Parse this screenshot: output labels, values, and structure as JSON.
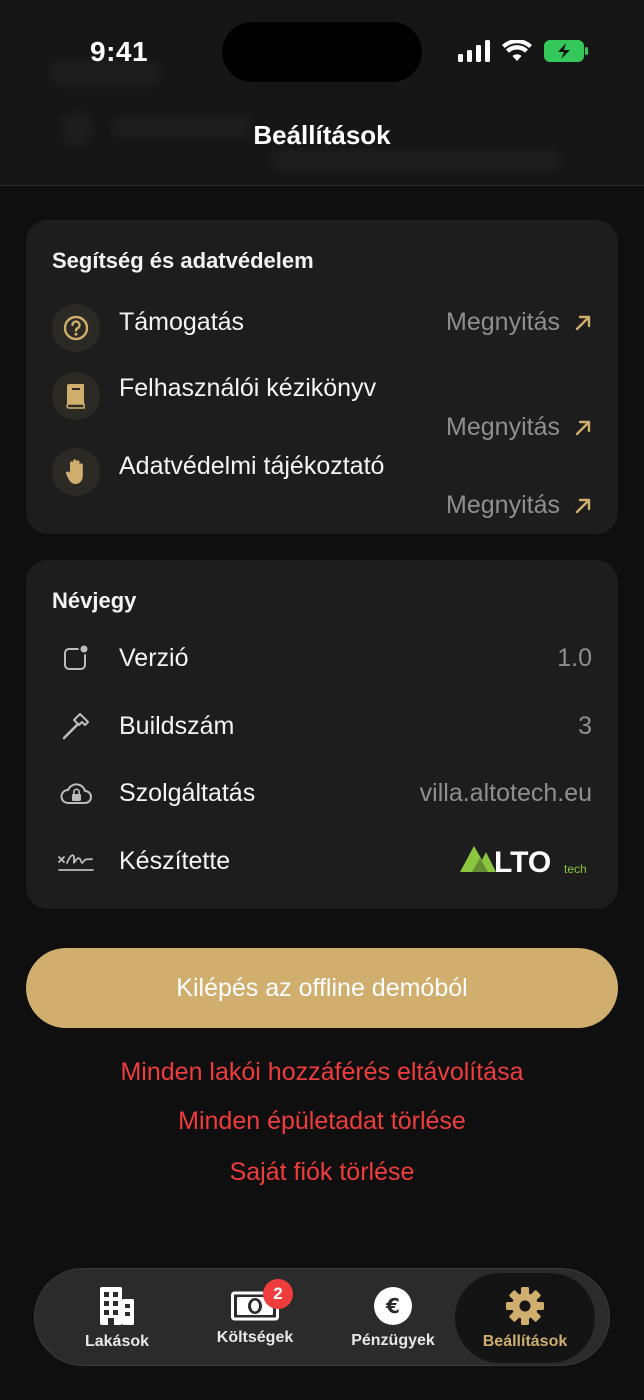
{
  "status_bar": {
    "time": "9:41"
  },
  "header": {
    "title": "Beállítások"
  },
  "help_section": {
    "title": "Segítség és adatvédelem",
    "items": [
      {
        "label": "Támogatás",
        "action": "Megnyitás",
        "icon": "question-circle-icon"
      },
      {
        "label": "Felhasználói kézikönyv",
        "action": "Megnyitás",
        "icon": "book-icon"
      },
      {
        "label": "Adatvédelmi tájékoztató",
        "action": "Megnyitás",
        "icon": "hand-icon"
      }
    ]
  },
  "about_section": {
    "title": "Névjegy",
    "items": [
      {
        "label": "Verzió",
        "value": "1.0",
        "icon": "app-badge-icon"
      },
      {
        "label": "Buildszám",
        "value": "3",
        "icon": "hammer-icon"
      },
      {
        "label": "Szolgáltatás",
        "value": "villa.altotech.eu",
        "icon": "cloud-lock-icon"
      },
      {
        "label": "Készítette",
        "value": "ALTO tech",
        "icon": "signature-icon"
      }
    ]
  },
  "primary_button": {
    "label": "Kilépés az offline demóból"
  },
  "danger_actions": [
    "Minden lakói hozzáférés eltávolítása",
    "Minden épületadat törlése",
    "Saját fiók törlése"
  ],
  "tabs": [
    {
      "label": "Lakások",
      "icon": "building-icon"
    },
    {
      "label": "Költségek",
      "icon": "banknote-icon",
      "badge": "2"
    },
    {
      "label": "Pénzügyek",
      "icon": "euro-icon"
    },
    {
      "label": "Beállítások",
      "icon": "gear-icon",
      "active": true
    }
  ],
  "colors": {
    "accent": "#cfae6e",
    "danger": "#ef3d3d",
    "background": "#0f0f0f",
    "card": "#1d1d1d"
  }
}
